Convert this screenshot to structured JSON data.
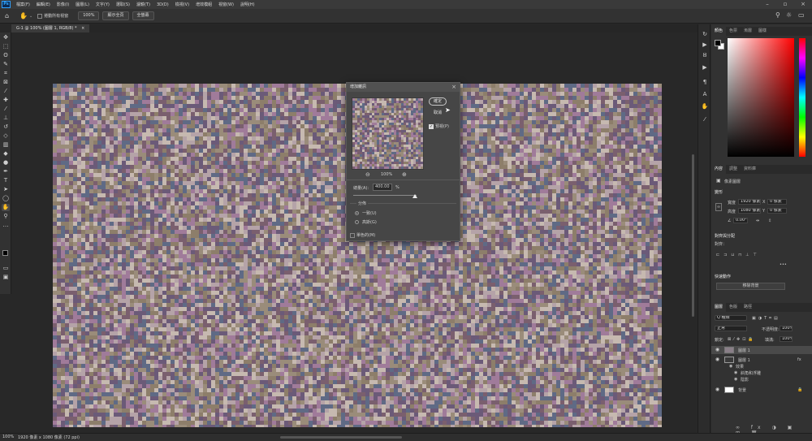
{
  "app": {
    "logo": "Ps",
    "menus": [
      "檔案(F)",
      "編輯(E)",
      "影像(I)",
      "圖層(L)",
      "文字(Y)",
      "選取(S)",
      "濾鏡(T)",
      "3D(D)",
      "檢視(V)",
      "增效模組",
      "視窗(W)",
      "說明(H)"
    ]
  },
  "options_bar": {
    "scroll_all_label": "捲動所有視窗",
    "zoom_value": "100%",
    "fit_screen_label": "顯示全頁",
    "fill_screen_label": "全螢幕"
  },
  "document": {
    "tab_title": "G-1 @ 100% (圖層 1, RGB/8) *",
    "close_glyph": "×",
    "canvas_noise_colors": [
      "#6b5a78",
      "#b5a3a8",
      "#8d7e6a",
      "#a07b9a",
      "#c6b9b0",
      "#5f6a85",
      "#9a8c7a",
      "#7a5f6e"
    ]
  },
  "dialog": {
    "title": "增加雜訊",
    "ok_label": "確定",
    "cancel_label": "取消",
    "preview_label": "預視(P)",
    "zoom_value": "100%",
    "amount_label": "總量(A):",
    "amount_value": "400.00",
    "amount_unit": "%",
    "amount_slider_fraction": 0.98,
    "distribution_label": "分佈",
    "uniform_label": "一致(U)",
    "gaussian_label": "高斯(G)",
    "monochromatic_label": "單色的(M)",
    "selected_distribution": "uniform"
  },
  "color_panel": {
    "tabs": [
      "顏色",
      "色票",
      "漸層",
      "圖樣"
    ],
    "active_tab": "顏色",
    "foreground": "#000000",
    "background": "#ffffff",
    "hue_color": "#ff0000"
  },
  "properties_panel": {
    "tabs": [
      "內容",
      "調整",
      "資料庫"
    ],
    "active_tab": "內容",
    "type_label": "像素圖層",
    "transform_section": "變形",
    "width_label": "寬度",
    "width_value": "1920 像素",
    "x_label": "X",
    "x_value": "0 像素",
    "height_label": "高度",
    "height_value": "1080 像素",
    "y_label": "Y",
    "y_value": "0 像素",
    "angle_value": "0.00°",
    "align_section": "對齊與分配",
    "align_label": "對齊：",
    "more_glyph": "•••",
    "quick_actions_section": "快速動作",
    "remove_bg_label": "移除背景"
  },
  "layers_panel": {
    "tabs": [
      "圖層",
      "色版",
      "路徑"
    ],
    "active_tab": "圖層",
    "search_placeholder": "Q 種類",
    "blend_mode": "正常",
    "opacity_label": "不透明度:",
    "opacity_value": "100%",
    "lock_label": "鎖定:",
    "fill_label": "填滿:",
    "fill_value": "100%",
    "layers": [
      {
        "name": "圖層 1",
        "selected": true
      },
      {
        "name": "圖層 1",
        "selected": false,
        "fx": "fx"
      },
      {
        "name": "效果",
        "sub": true
      },
      {
        "name": "斜角和浮雕",
        "sub": true
      },
      {
        "name": "陰影",
        "sub": true
      },
      {
        "name": "背景",
        "selected": false
      }
    ]
  },
  "statusbar": {
    "zoom": "100%",
    "doc_info": "1920 像素 x 1080 像素 (72 ppi)"
  }
}
